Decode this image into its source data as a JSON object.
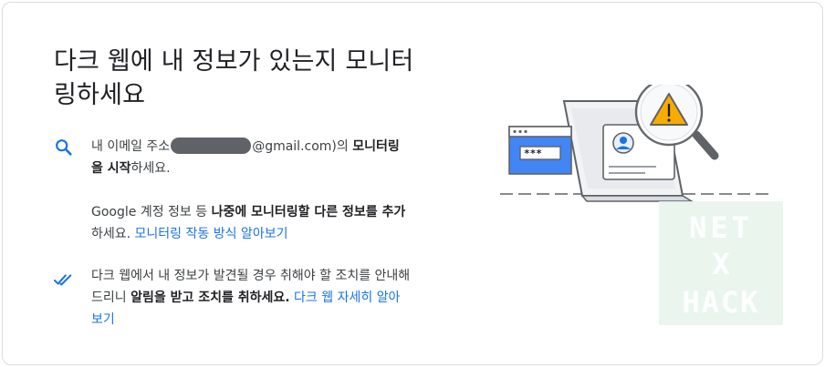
{
  "title": "다크 웹에 내 정보가 있는지 모니터링하세요",
  "section1": {
    "icon": "search-icon",
    "line1_pre": "내 이메일 주소",
    "line1_post": "@gmail.com)의",
    "line1_bold": "모니터링을 시작",
    "line1_end": "하세요.",
    "line2_pre": "Google 계정 정보 등",
    "line2_bold": "나중에 모니터링할 다른 정보를 추가",
    "line2_end": "하세요.",
    "line2_link": "모니터링 작동 방식 알아보기"
  },
  "section2": {
    "icon": "double-check-icon",
    "text_pre": "다크 웹에서 내 정보가 발견될 경우 취해야 할 조치를 안내해 드리니",
    "text_bold": "알림을 받고 조치를 취하세요.",
    "link": "다크 웹 자세히 알아보기"
  },
  "illustration": {
    "password_mask": "***",
    "icon": "warning-icon"
  },
  "watermark": {
    "lines": [
      "NET",
      "X",
      "HACK"
    ]
  },
  "colors": {
    "accent": "#1a73e8",
    "warning": "#f9ab00",
    "watermark": "#e6f4ea"
  }
}
